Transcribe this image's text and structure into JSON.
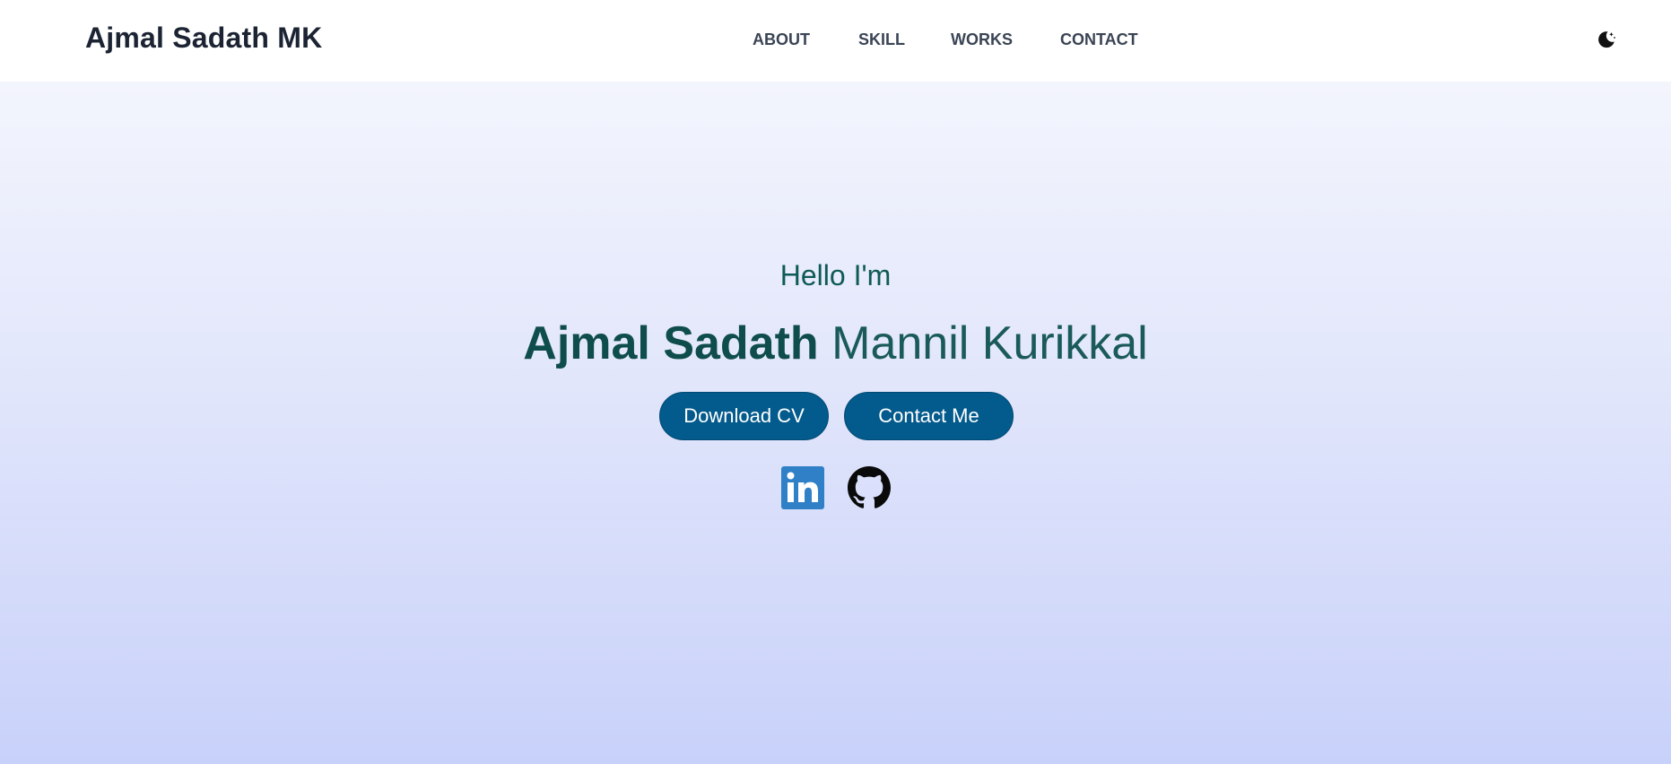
{
  "header": {
    "brand": "Ajmal Sadath MK",
    "nav": [
      {
        "label": "ABOUT"
      },
      {
        "label": "SKILL"
      },
      {
        "label": "WORKS"
      },
      {
        "label": "CONTACT"
      }
    ],
    "theme_icon": "moon-icon"
  },
  "hero": {
    "greeting": "Hello I'm",
    "name_first": "Ajmal Sadath",
    "name_last": "Mannil Kurikkal",
    "buttons": {
      "download_cv": "Download CV",
      "contact_me": "Contact Me"
    },
    "social": [
      {
        "icon": "linkedin-icon"
      },
      {
        "icon": "github-icon"
      }
    ]
  },
  "colors": {
    "accent": "#035a8c",
    "heading": "#0e4d4b",
    "brand_text": "#1c2433",
    "linkedin": "#2f80c7"
  }
}
